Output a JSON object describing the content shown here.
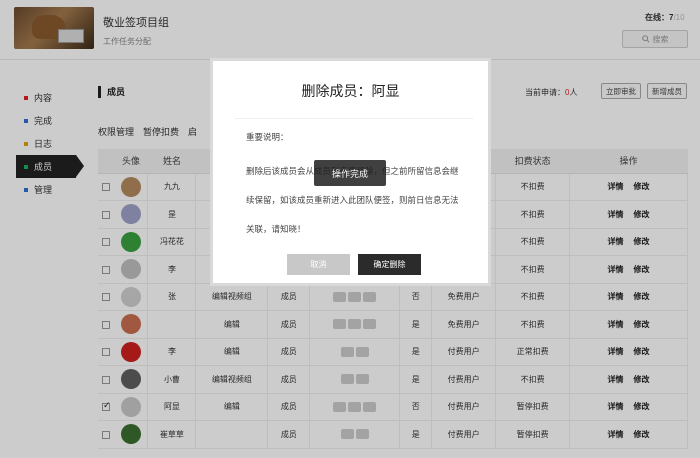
{
  "header": {
    "project_title": "敬业签项目组",
    "project_subtitle": "工作任务分配",
    "online_label": "在线：",
    "online_count": "7",
    "online_total": "/10",
    "search_label": "搜索"
  },
  "sidebar": {
    "items": [
      {
        "label": "内容",
        "color": "#e02020"
      },
      {
        "label": "完成",
        "color": "#2f6fd6"
      },
      {
        "label": "日志",
        "color": "#e0a010"
      },
      {
        "label": "成员",
        "color": "#18b060"
      },
      {
        "label": "管理",
        "color": "#2f6fd6"
      }
    ]
  },
  "content": {
    "title": "成员",
    "pending_label": "当前申请：",
    "pending_count": "0",
    "pending_unit": "人",
    "approve_button": "立即审批",
    "add_button": "新增成员",
    "tabs": [
      "权限管理",
      "暂停扣费",
      "启"
    ]
  },
  "table": {
    "headers": [
      "头像",
      "姓名",
      "",
      "",
      "",
      "",
      "",
      "扣费状态",
      "操作"
    ],
    "rows": [
      {
        "checked": false,
        "name": "九九",
        "group": "",
        "role": "",
        "device": "",
        "bind": "",
        "user": "",
        "status": "不扣费",
        "avatar_color": "#b58a60"
      },
      {
        "checked": false,
        "name": "昰",
        "group": "",
        "role": "",
        "device": "",
        "bind": "",
        "user": "",
        "status": "不扣费",
        "avatar_color": "#9ea3c8"
      },
      {
        "checked": false,
        "name": "冯花花",
        "group": "",
        "role": "",
        "device": "",
        "bind": "",
        "user": "",
        "status": "不扣费",
        "avatar_color": "#3aa040"
      },
      {
        "checked": false,
        "name": "李",
        "group": "",
        "role": "",
        "device": "",
        "bind": "",
        "user": "",
        "status": "不扣费",
        "avatar_color": "#c0c0c0"
      },
      {
        "checked": false,
        "name": "张",
        "group": "编辑视频组",
        "role": "成员",
        "device": "icons3",
        "bind": "否",
        "user": "免费用户",
        "status": "不扣费",
        "avatar_color": "#d0d0d0"
      },
      {
        "checked": false,
        "name": "",
        "group": "编辑",
        "role": "成员",
        "device": "icons3",
        "bind": "是",
        "user": "免费用户",
        "status": "不扣费",
        "avatar_color": "#c87050"
      },
      {
        "checked": false,
        "name": "李",
        "group": "编辑",
        "role": "成员",
        "device": "icons2",
        "bind": "是",
        "user": "付费用户",
        "status": "正常扣费",
        "avatar_color": "#d02020"
      },
      {
        "checked": false,
        "name": "小曹",
        "group": "编辑视频组",
        "role": "成员",
        "device": "icons2",
        "bind": "是",
        "user": "付费用户",
        "status": "不扣费",
        "avatar_color": "#606060"
      },
      {
        "checked": true,
        "name": "阿显",
        "group": "编辑",
        "role": "成员",
        "device": "icons3",
        "bind": "否",
        "user": "付费用户",
        "status": "暂停扣费",
        "avatar_color": "#c8c8c8"
      },
      {
        "checked": false,
        "name": "崔草草",
        "group": "",
        "role": "成员",
        "device": "icons2",
        "bind": "是",
        "user": "付费用户",
        "status": "暂停扣费",
        "avatar_color": "#3a7030"
      }
    ],
    "op_detail": "详情",
    "op_edit": "修改"
  },
  "modal": {
    "title": "删除成员：阿显",
    "heading": "重要说明：",
    "body": "删除后该成员会从成员列表里移除，但之前所留信息会继续保留，如该成员重新进入此团队便签，则前日信息无法关联，请知晓！",
    "cancel_label": "取消",
    "confirm_label": "确定删除"
  },
  "toast": {
    "text": "操作完成"
  }
}
